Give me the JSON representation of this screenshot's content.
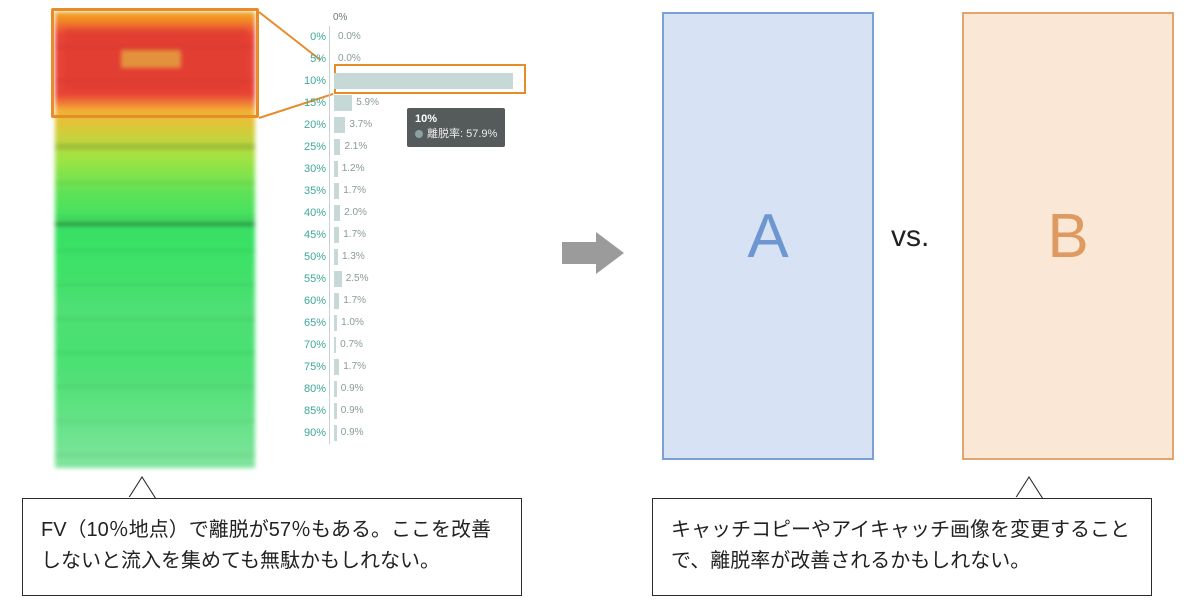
{
  "chart_data": {
    "type": "bar",
    "top_label": "0%",
    "categories": [
      "0%",
      "5%",
      "10%",
      "15%",
      "20%",
      "25%",
      "30%",
      "35%",
      "40%",
      "45%",
      "50%",
      "55%",
      "60%",
      "65%",
      "70%",
      "75%",
      "80%",
      "85%",
      "90%"
    ],
    "values": [
      0.0,
      0.0,
      57.9,
      5.9,
      3.7,
      2.1,
      1.2,
      1.7,
      2.0,
      1.7,
      1.3,
      2.5,
      1.7,
      1.0,
      0.7,
      1.7,
      0.9,
      0.9,
      0.9
    ],
    "value_labels": [
      "0.0%",
      "0.0%",
      "",
      "5.9%",
      "3.7%",
      "2.1%",
      "1.2%",
      "1.7%",
      "2.0%",
      "1.7%",
      "1.3%",
      "2.5%",
      "1.7%",
      "1.0%",
      "0.7%",
      "1.7%",
      "0.9%",
      "0.9%",
      "0.9%"
    ],
    "xlim": [
      0,
      60
    ],
    "ylabel": "離脱率",
    "xlabel": ""
  },
  "tooltip": {
    "line1": "10%",
    "line2_label": "離脱率:",
    "line2_value": "57.9%"
  },
  "ab": {
    "a_label": "A",
    "b_label": "B",
    "vs_label": "vs."
  },
  "annotations": {
    "left": "FV（10％地点）で離脱が57％もある。ここを改善しないと流入を集めても無駄かもしれない。",
    "right": "キャッチコピーやアイキャッチ画像を変更することで、離脱率が改善されるかもしれない。"
  }
}
